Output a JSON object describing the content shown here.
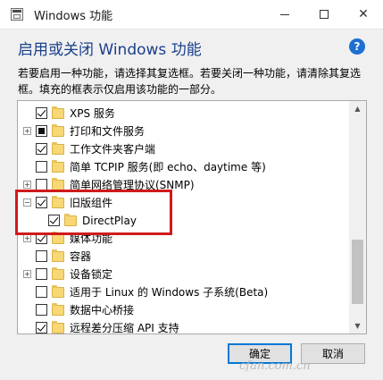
{
  "window": {
    "title": "Windows 功能",
    "minimize_label": "",
    "maximize_label": "",
    "close_label": "✕"
  },
  "heading": "启用或关闭 Windows 功能",
  "help_icon": "?",
  "description": "若要启用一种功能，请选择其复选框。若要关闭一种功能，请清除其复选框。填充的框表示仅启用该功能的一部分。",
  "features": [
    {
      "label": "XPS 服务",
      "state": "checked",
      "expander": ""
    },
    {
      "label": "打印和文件服务",
      "state": "partial",
      "expander": "+"
    },
    {
      "label": "工作文件夹客户端",
      "state": "checked",
      "expander": ""
    },
    {
      "label": "简单 TCPIP 服务(即 echo、daytime 等)",
      "state": "unchecked",
      "expander": ""
    },
    {
      "label": "简单网络管理协议(SNMP)",
      "state": "unchecked",
      "expander": "+"
    },
    {
      "label": "旧版组件",
      "state": "checked",
      "expander": "−"
    },
    {
      "label": "DirectPlay",
      "state": "checked",
      "expander": ""
    },
    {
      "label": "媒体功能",
      "state": "checked",
      "expander": "+"
    },
    {
      "label": "容器",
      "state": "unchecked",
      "expander": ""
    },
    {
      "label": "设备锁定",
      "state": "unchecked",
      "expander": "+"
    },
    {
      "label": "适用于 Linux 的 Windows 子系统(Beta)",
      "state": "unchecked",
      "expander": ""
    },
    {
      "label": "数据中心桥接",
      "state": "unchecked",
      "expander": ""
    },
    {
      "label": "远程差分压缩 API 支持",
      "state": "checked",
      "expander": ""
    }
  ],
  "scrollbar": {
    "up_arrow": "▲",
    "down_arrow": "▼"
  },
  "buttons": {
    "ok": "确定",
    "cancel": "取消"
  },
  "watermark": "cfan.com.cn",
  "colors": {
    "heading": "#1a3f8a",
    "highlight": "#d11a1a",
    "folder": "#f8d775",
    "ok_border": "#0078d7"
  }
}
